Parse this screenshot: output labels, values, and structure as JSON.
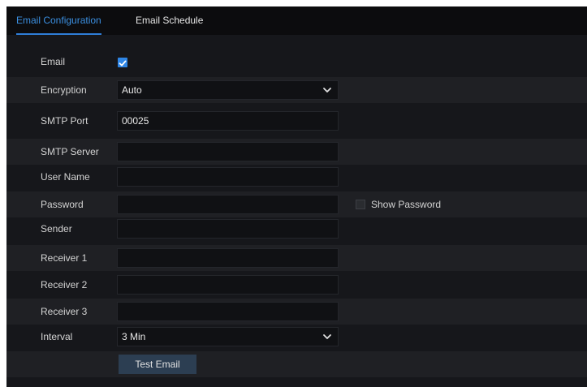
{
  "tabs": [
    {
      "label": "Email Configuration",
      "active": true
    },
    {
      "label": "Email Schedule",
      "active": false
    }
  ],
  "form": {
    "email": {
      "label": "Email",
      "checked": true
    },
    "encryption": {
      "label": "Encryption",
      "value": "Auto"
    },
    "smtp_port": {
      "label": "SMTP Port",
      "value": "00025"
    },
    "smtp_server": {
      "label": "SMTP Server",
      "value": ""
    },
    "user_name": {
      "label": "User Name",
      "value": ""
    },
    "password": {
      "label": "Password",
      "value": "",
      "show_label": "Show Password",
      "show_checked": false
    },
    "sender": {
      "label": "Sender",
      "value": ""
    },
    "receiver1": {
      "label": "Receiver 1",
      "value": ""
    },
    "receiver2": {
      "label": "Receiver 2",
      "value": ""
    },
    "receiver3": {
      "label": "Receiver 3",
      "value": ""
    },
    "interval": {
      "label": "Interval",
      "value": "3 Min"
    },
    "test_button": "Test Email"
  },
  "colors": {
    "accent": "#2f86e6",
    "panel_bg": "#16171b",
    "row_shade": "#1f2024",
    "button_bg": "#2c3e52"
  }
}
